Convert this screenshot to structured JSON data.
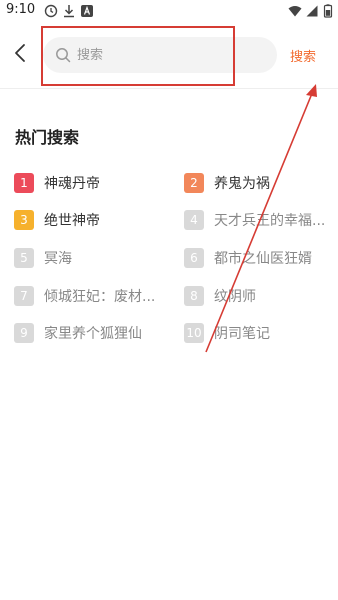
{
  "status_bar": {
    "time": "9:10",
    "icons": [
      "alarm-icon",
      "download-icon",
      "app-a-icon",
      "wifi-icon",
      "signal-icon",
      "battery-icon"
    ]
  },
  "header": {
    "back_icon": "chevron-left-icon",
    "search_placeholder": "搜索",
    "search_value": "",
    "search_button_label": "搜索",
    "accent_color": "#f26a2f"
  },
  "hot_search": {
    "title": "热门搜索",
    "items": [
      {
        "rank": "1",
        "title": "神魂丹帝",
        "badge_color": "#ec4b5a"
      },
      {
        "rank": "2",
        "title": "养鬼为祸",
        "badge_color": "#f2875a"
      },
      {
        "rank": "3",
        "title": "绝世神帝",
        "badge_color": "#f6b12d"
      },
      {
        "rank": "4",
        "title": "天才兵王的幸福...",
        "badge_color": "#d9d9d9"
      },
      {
        "rank": "5",
        "title": "冥海",
        "badge_color": "#d9d9d9"
      },
      {
        "rank": "6",
        "title": "都市之仙医狂婿",
        "badge_color": "#d9d9d9"
      },
      {
        "rank": "7",
        "title": "倾城狂妃：废材...",
        "badge_color": "#d9d9d9"
      },
      {
        "rank": "8",
        "title": "纹阴师",
        "badge_color": "#d9d9d9"
      },
      {
        "rank": "9",
        "title": "家里养个狐狸仙",
        "badge_color": "#d9d9d9"
      },
      {
        "rank": "10",
        "title": "阴司笔记",
        "badge_color": "#d9d9d9"
      }
    ]
  },
  "annotation": {
    "color": "#d63c34"
  }
}
